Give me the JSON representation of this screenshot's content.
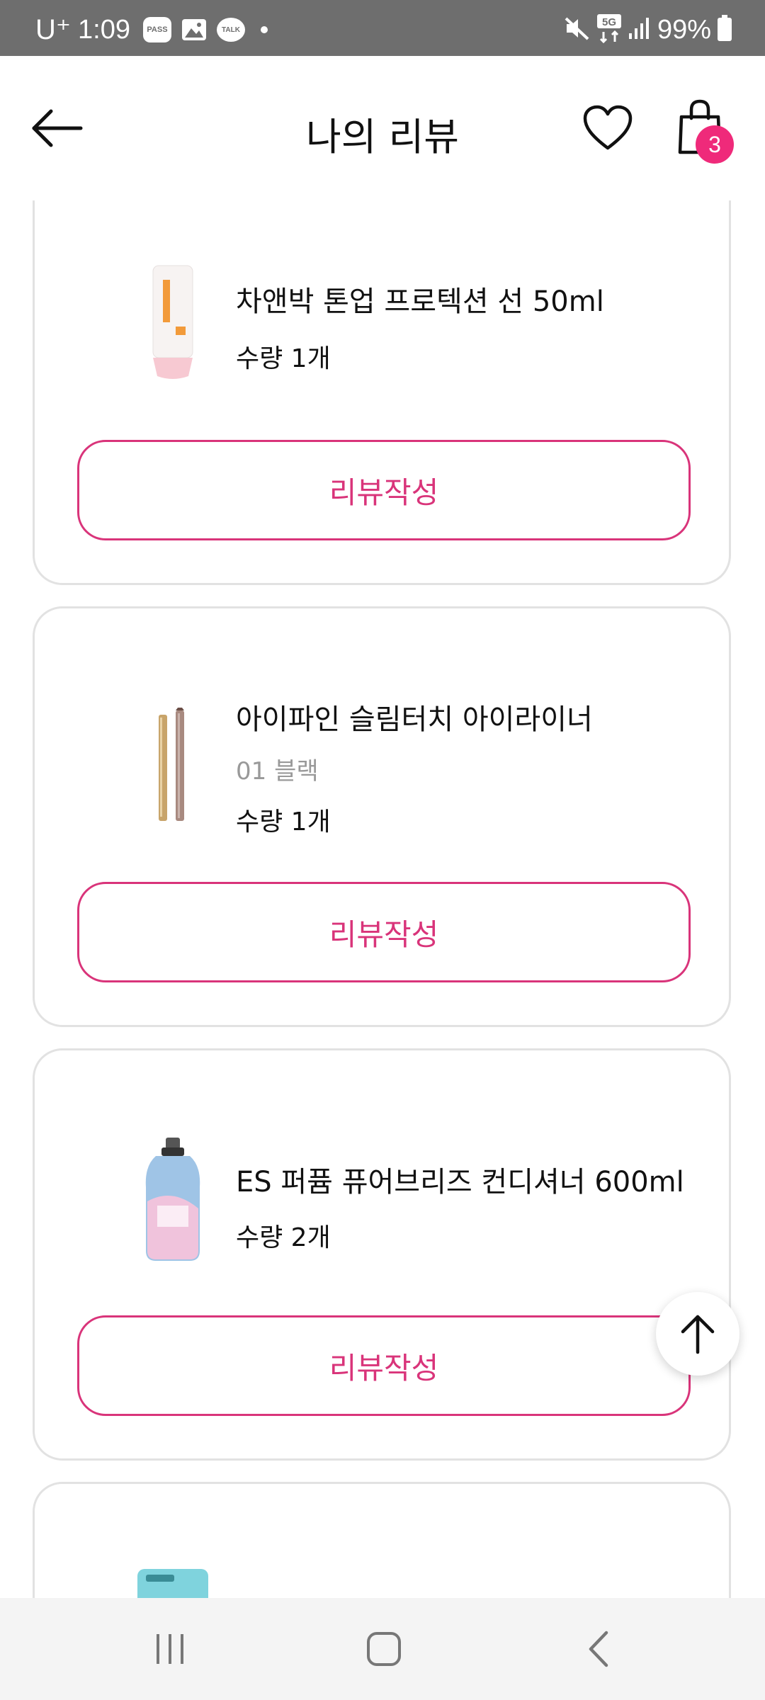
{
  "status_bar": {
    "carrier": "U⁺",
    "time": "1:09",
    "notification_chips": [
      "PASS",
      "TALK"
    ],
    "network": "5G",
    "battery": "99%"
  },
  "header": {
    "title": "나의 리뷰",
    "cart_count": "3",
    "icons": [
      "back-arrow-icon",
      "heart-icon",
      "shopping-bag-icon"
    ]
  },
  "reviews": [
    {
      "name": "차앤박 톤업 프로텍션 선 50ml",
      "option": "",
      "quantity": "수량 1개",
      "button_label": "리뷰작성"
    },
    {
      "name": "아이파인 슬림터치 아이라이너",
      "option": "01 블랙",
      "quantity": "수량 1개",
      "button_label": "리뷰작성"
    },
    {
      "name": "ES 퍼퓸 퓨어브리즈 컨디셔너 600ml",
      "option": "",
      "quantity": "수량 2개",
      "button_label": "리뷰작성"
    }
  ],
  "colors": {
    "accent": "#d9347a",
    "badge": "#ef2a7a",
    "card_border": "#e2e2e2",
    "status_bar_bg": "#6e6e6e",
    "nav_bar_bg": "#f4f4f4"
  },
  "nav": [
    "recent-apps-icon",
    "home-icon",
    "back-icon"
  ]
}
